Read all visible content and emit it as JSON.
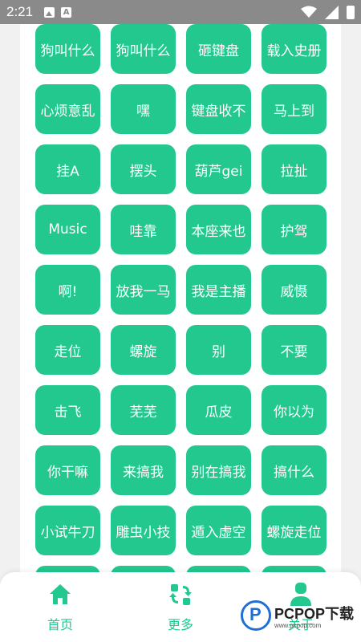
{
  "status_bar": {
    "time": "2:21",
    "left_icons": [
      "image-icon",
      "font-icon"
    ],
    "right_icons": [
      "wifi-icon",
      "signal-icon",
      "battery-icon"
    ]
  },
  "buttons": [
    "狗叫什么",
    "狗叫什么",
    "砸键盘",
    "载入史册",
    "心烦意乱",
    "嘿",
    "键盘收不",
    "马上到",
    "挂A",
    "摆头",
    "葫芦gei",
    "拉扯",
    "Music",
    "哇靠",
    "本座来也",
    "护驾",
    "啊!",
    "放我一马",
    "我是主播",
    "威慑",
    "走位",
    "螺旋",
    "别",
    "不要",
    "击飞",
    "芜芜",
    "瓜皮",
    "你以为",
    "你干嘛",
    "来搞我",
    "别在搞我",
    "搞什么",
    "小试牛刀",
    "雕虫小技",
    "遁入虚空",
    "螺旋走位"
  ],
  "nav": {
    "home": {
      "label": "首页",
      "icon": "home-icon"
    },
    "more": {
      "label": "更多",
      "icon": "swap-icon"
    },
    "about": {
      "label": "关于",
      "icon": "user-icon"
    }
  },
  "watermark": {
    "main": "PCPOP下载",
    "sub": "www.pcpop.com"
  },
  "colors": {
    "accent": "#22c88e",
    "status_bar": "#8a8a8a",
    "background": "#f0f1f0"
  }
}
